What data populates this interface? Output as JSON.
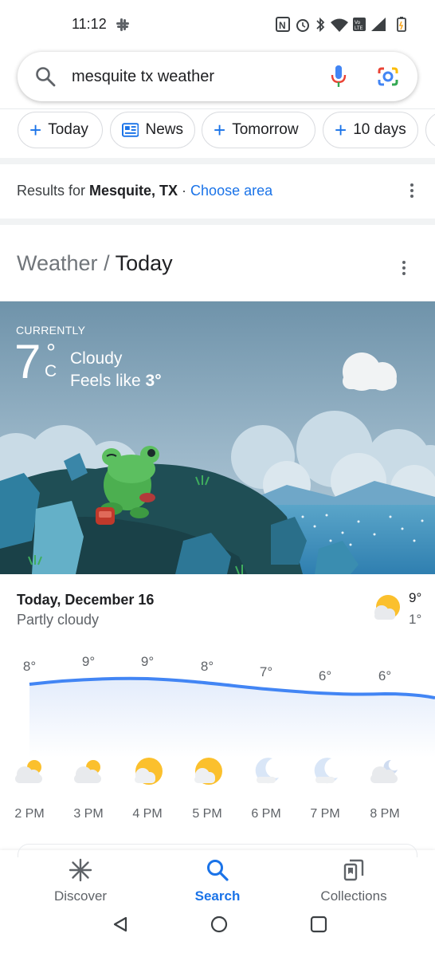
{
  "status_bar": {
    "time": "11:12",
    "icons": [
      "slack-icon",
      "nfc-icon",
      "alarm-icon",
      "bluetooth-icon",
      "wifi-icon",
      "volte-icon",
      "signal-icon",
      "battery-icon"
    ]
  },
  "search": {
    "query": "mesquite tx weather",
    "icons": [
      "search-icon",
      "mic-icon",
      "lens-icon"
    ]
  },
  "chips": [
    {
      "label": "Today",
      "icon": "plus"
    },
    {
      "label": "News",
      "icon": "news"
    },
    {
      "label": "Tomorrow",
      "icon": "plus"
    },
    {
      "label": "10 days",
      "icon": "plus"
    }
  ],
  "results": {
    "prefix": "Results for ",
    "location": "Mesquite, TX",
    "separator": " · ",
    "link": "Choose area"
  },
  "weather_card": {
    "breadcrumb_root": "Weather",
    "breadcrumb_sep": " / ",
    "breadcrumb_current": "Today",
    "currently_label": "CURRENTLY",
    "temp": "7",
    "degree": "°",
    "unit": "C",
    "condition": "Cloudy",
    "feels_like_label": "Feels like ",
    "feels_like_value": "3°"
  },
  "forecast": {
    "day_title": "Today, December 16",
    "day_condition": "Partly cloudy",
    "high": "9°",
    "low": "1°",
    "hours": [
      {
        "temp": "8°",
        "time": "2 PM",
        "icon": "partly-cloudy"
      },
      {
        "temp": "9°",
        "time": "3 PM",
        "icon": "partly-cloudy"
      },
      {
        "temp": "9°",
        "time": "4 PM",
        "icon": "mostly-sunny"
      },
      {
        "temp": "8°",
        "time": "5 PM",
        "icon": "mostly-sunny"
      },
      {
        "temp": "7°",
        "time": "6 PM",
        "icon": "clear-night"
      },
      {
        "temp": "6°",
        "time": "7 PM",
        "icon": "clear-night"
      },
      {
        "temp": "6°",
        "time": "8 PM",
        "icon": "partly-cloudy-night"
      }
    ]
  },
  "bottom_nav": {
    "items": [
      {
        "label": "Discover",
        "icon": "asterisk-icon"
      },
      {
        "label": "Search",
        "icon": "search-icon",
        "active": true
      },
      {
        "label": "Collections",
        "icon": "collections-icon"
      }
    ]
  },
  "colors": {
    "accent": "#1a73e8",
    "sky": "#7b9db2",
    "sun": "#fbc02d"
  }
}
